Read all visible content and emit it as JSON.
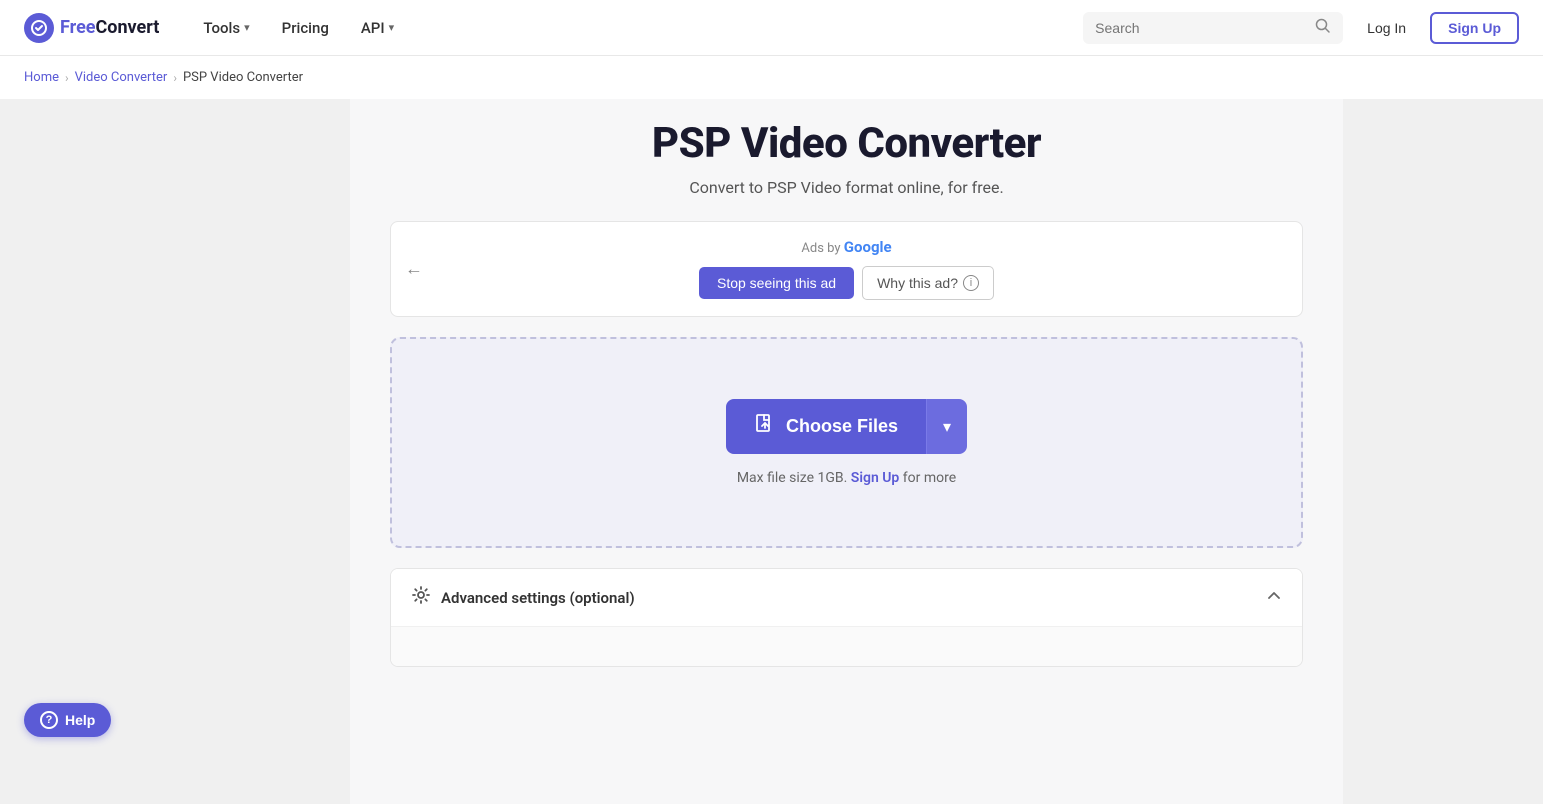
{
  "header": {
    "logo_free": "Free",
    "logo_convert": "Convert",
    "nav": {
      "tools_label": "Tools",
      "pricing_label": "Pricing",
      "api_label": "API"
    },
    "search_placeholder": "Search",
    "login_label": "Log In",
    "signup_label": "Sign Up"
  },
  "breadcrumb": {
    "home": "Home",
    "video_converter": "Video Converter",
    "current": "PSP Video Converter"
  },
  "main": {
    "page_title": "PSP Video Converter",
    "page_subtitle": "Convert to PSP Video format online, for free.",
    "ads": {
      "ads_by": "Ads by",
      "google": "Google",
      "stop_ad_label": "Stop seeing this ad",
      "why_ad_label": "Why this ad?"
    },
    "upload": {
      "choose_files_label": "Choose Files",
      "max_size_text": "Max file size 1GB.",
      "signup_label": "Sign Up",
      "for_more": "for more"
    },
    "advanced": {
      "label": "Advanced settings (optional)"
    }
  },
  "help": {
    "label": "Help"
  }
}
